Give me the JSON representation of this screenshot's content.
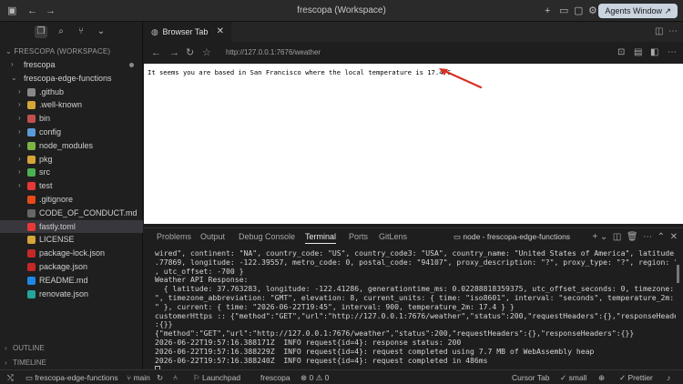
{
  "window": {
    "title": "frescopa (Workspace)",
    "agents_button": "Agents Window ↗"
  },
  "sidebar": {
    "workspace_header": "FRESCOPA (WORKSPACE)",
    "items": [
      {
        "name": "frescopa",
        "type": "folder",
        "expanded": false,
        "depth": 0,
        "modified": true
      },
      {
        "name": "frescopa-edge-functions",
        "type": "folder",
        "expanded": true,
        "depth": 0
      },
      {
        "name": ".github",
        "type": "folder",
        "depth": 1,
        "color": "#888888"
      },
      {
        "name": ".well-known",
        "type": "folder",
        "depth": 1,
        "color": "#d4a537"
      },
      {
        "name": "bin",
        "type": "folder",
        "depth": 1,
        "color": "#c0504d"
      },
      {
        "name": "config",
        "type": "folder",
        "depth": 1,
        "color": "#5b9bd5"
      },
      {
        "name": "node_modules",
        "type": "folder",
        "depth": 1,
        "color": "#7cb342"
      },
      {
        "name": "pkg",
        "type": "folder",
        "depth": 1,
        "color": "#d4a537"
      },
      {
        "name": "src",
        "type": "folder",
        "depth": 1,
        "color": "#4caf50"
      },
      {
        "name": "test",
        "type": "folder",
        "depth": 1,
        "color": "#e53935"
      },
      {
        "name": ".gitignore",
        "type": "file",
        "depth": 1,
        "color": "#e64a19"
      },
      {
        "name": "CODE_OF_CONDUCT.md",
        "type": "file",
        "depth": 1,
        "color": "#666666"
      },
      {
        "name": "fastly.toml",
        "type": "file",
        "depth": 1,
        "color": "#e53935",
        "selected": true
      },
      {
        "name": "LICENSE",
        "type": "file",
        "depth": 1,
        "color": "#d4a537"
      },
      {
        "name": "package-lock.json",
        "type": "file",
        "depth": 1,
        "color": "#c62828"
      },
      {
        "name": "package.json",
        "type": "file",
        "depth": 1,
        "color": "#c62828"
      },
      {
        "name": "README.md",
        "type": "file",
        "depth": 1,
        "color": "#1e88e5"
      },
      {
        "name": "renovate.json",
        "type": "file",
        "depth": 1,
        "color": "#26a69a"
      }
    ],
    "outline_label": "OUTLINE",
    "timeline_label": "TIMELINE"
  },
  "editor": {
    "tab_label": "Browser Tab",
    "url": "http://127.0.0.1:7676/weather",
    "page_text": "It seems you are based in San Francisco where the local temperature is 17.4°C",
    "arrow_color": "#d93025"
  },
  "panel": {
    "tabs": [
      "Problems",
      "Output",
      "Debug Console",
      "Terminal",
      "Ports",
      "GitLens"
    ],
    "active_tab": "Terminal",
    "terminal_title": "node - frescopa-edge-functions",
    "lines": [
      "wired\", continent: \"NA\", country_code: \"US\", country_code3: \"USA\", country_name: \"United States of America\", latitude: 37",
      ".77869, longitude: -122.39557, metro_code: 0, postal_code: \"94107\", proxy_description: \"?\", proxy_type: \"?\", region: \"CA\"",
      ", utc_offset: -700 }",
      "Weather API Response:",
      "  { latitude: 37.763283, longitude: -122.41286, generationtime_ms: 0.02288818359375, utc_offset_seconds: 0, timezone: \"GMT",
      "\", timezone_abbreviation: \"GMT\", elevation: 8, current_units: { time: \"iso8601\", interval: \"seconds\", temperature_2m: \"°C",
      "\" }, current: { time: \"2026-06-22T19:45\", interval: 900, temperature_2m: 17.4 } }",
      "customerHttps :: {\"method\":\"GET\",\"url\":\"http://127.0.0.1:7676/weather\",\"status\":200,\"requestHeaders\":{},\"responseHeaders\"",
      ":{}}",
      "{\"method\":\"GET\",\"url\":\"http://127.0.0.1:7676/weather\",\"status\":200,\"requestHeaders\":{},\"responseHeaders\":{}}",
      "2026-06-22T19:57:16.388171Z  INFO request{id=4}: response status: 200",
      "2026-06-22T19:57:16.388229Z  INFO request{id=4}: request completed using 7.7 MB of WebAssembly heap",
      "2026-06-22T19:57:16.388240Z  INFO request{id=4}: request completed in 486ms"
    ]
  },
  "statusbar": {
    "repo": "frescopa-edge-functions",
    "branch": "main",
    "launchpad": "Launchpad",
    "project": "frescopa",
    "problems": "0",
    "warnings": "0",
    "cursor_tab": "Cursor Tab",
    "model": "small",
    "prettier": "Prettier"
  }
}
